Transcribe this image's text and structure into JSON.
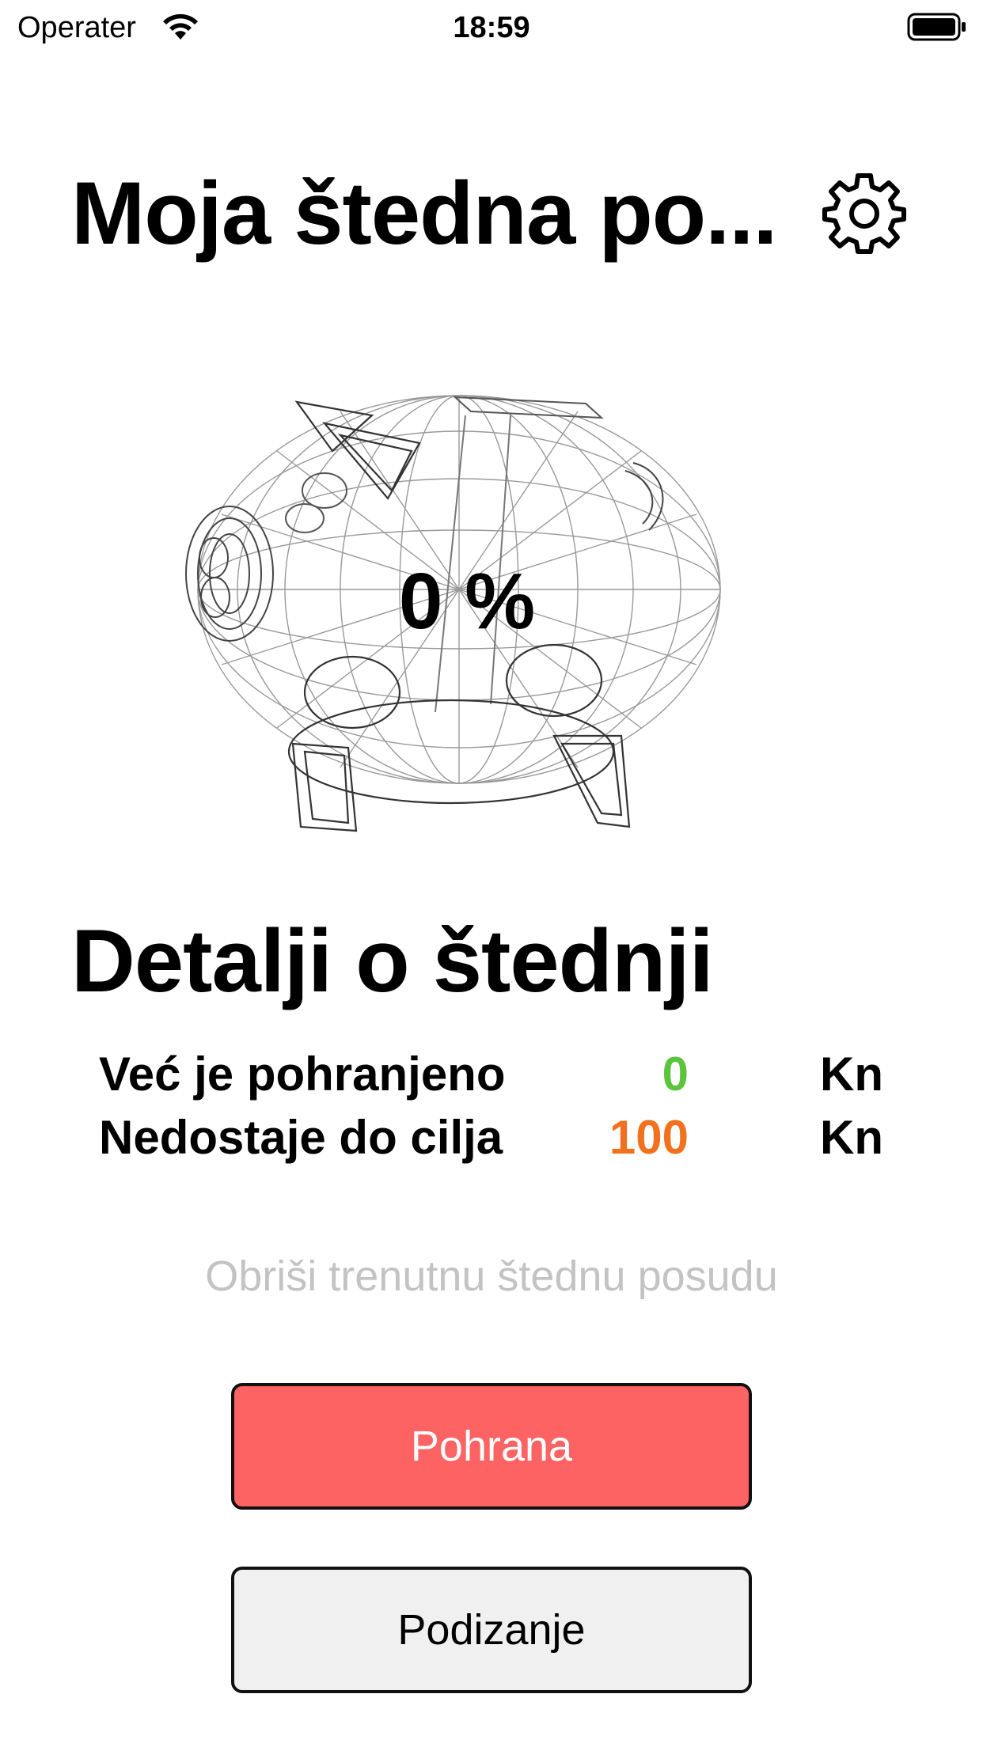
{
  "status_bar": {
    "carrier": "Operater",
    "time": "18:59",
    "wifi_icon": "wifi-icon",
    "battery_icon": "battery-full-icon"
  },
  "header": {
    "title": "Moja štedna po...",
    "settings_icon": "gear-icon"
  },
  "piggy_bank": {
    "icon": "piggy-bank-wireframe-3d",
    "percent_label": "0 %"
  },
  "details": {
    "title": "Detalji o štednji",
    "rows": [
      {
        "label": "Već je pohranjeno",
        "value": "0",
        "unit": "Kn",
        "color": "#5cc33c"
      },
      {
        "label": "Nedostaje do cilja",
        "value": "100",
        "unit": "Kn",
        "color": "#f2711e"
      }
    ]
  },
  "actions": {
    "delete_label": "Obriši trenutnu štednu posudu",
    "deposit_label": "Pohrana",
    "withdraw_label": "Podizanje"
  },
  "colors": {
    "deposit_bg": "#fd6363",
    "withdraw_bg": "#f0f0f0",
    "delete_text": "#c3c3c3"
  }
}
